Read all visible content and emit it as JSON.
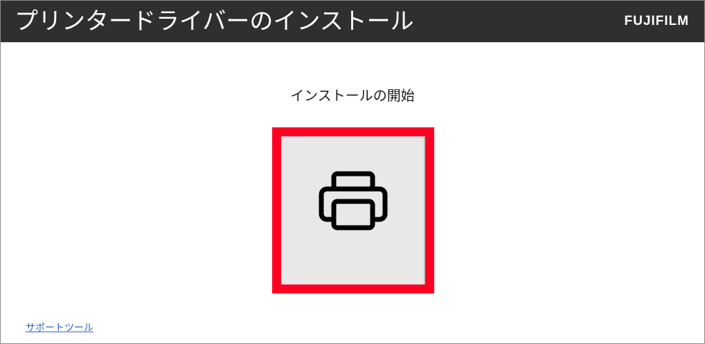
{
  "header": {
    "title": "プリンタードライバーのインストール",
    "brand": "FUJIFILM"
  },
  "main": {
    "heading": "インストールの開始",
    "install_button_icon": "printer-icon"
  },
  "footer": {
    "support_link": "サポートツール"
  },
  "colors": {
    "titlebar": "#2f2f2f",
    "button_bg": "#e8e8e8",
    "highlight_border": "#ff0024",
    "link": "#2a63c9"
  }
}
